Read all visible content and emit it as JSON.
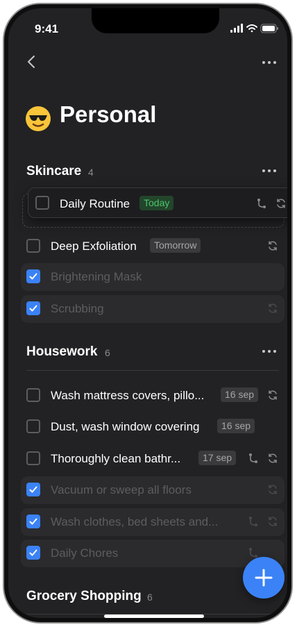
{
  "status_bar": {
    "time": "9:41"
  },
  "nav": {
    "back_icon": "chevron-left-icon",
    "more_icon": "ellipsis-icon"
  },
  "page": {
    "emoji": "smiling-face-with-sunglasses",
    "title": "Personal"
  },
  "sections": [
    {
      "title": "Skincare",
      "count": "4",
      "tasks": [
        {
          "label": "Daily Routine",
          "tag": "Today",
          "tag_style": "today",
          "checked": false,
          "icons": [
            "subtask-icon",
            "repeat-icon"
          ],
          "state": "dragging"
        },
        {
          "label": "Deep Exfoliation",
          "tag": "Tomorrow",
          "checked": false,
          "icons": [
            "repeat-icon"
          ]
        },
        {
          "label": "Brightening Mask",
          "tag": "",
          "checked": true,
          "icons": []
        },
        {
          "label": "Scrubbing",
          "tag": "",
          "checked": true,
          "icons": [
            "repeat-icon"
          ]
        }
      ]
    },
    {
      "title": "Housework",
      "count": "6",
      "tasks": [
        {
          "label": "Wash mattress covers, pillo...",
          "tag": "16 sep",
          "checked": false,
          "icons": [
            "repeat-icon"
          ]
        },
        {
          "label": "Dust, wash window covering",
          "tag": "16 sep",
          "checked": false,
          "icons": []
        },
        {
          "label": "Thoroughly clean bathr...",
          "tag": "17 sep",
          "checked": false,
          "icons": [
            "subtask-icon",
            "repeat-icon"
          ]
        },
        {
          "label": "Vacuum or sweep all floors",
          "tag": "",
          "checked": true,
          "icons": [
            "repeat-icon"
          ]
        },
        {
          "label": "Wash clothes, bed sheets and...",
          "tag": "",
          "checked": true,
          "icons": [
            "subtask-icon",
            "repeat-icon"
          ]
        },
        {
          "label": "Daily Chores",
          "tag": "",
          "checked": true,
          "icons": [
            "subtask-icon"
          ]
        }
      ]
    },
    {
      "title": "Grocery Shopping",
      "count": "6",
      "tasks": []
    }
  ],
  "fab": {
    "icon": "plus-icon"
  },
  "colors": {
    "accent": "#3b82f6",
    "background": "#222224",
    "today_tag": "#4fc36a"
  }
}
